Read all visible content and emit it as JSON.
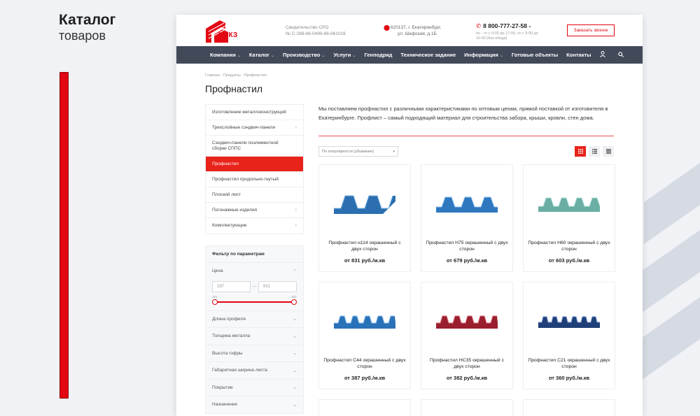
{
  "presentation": {
    "title_line1": "Каталог",
    "title_line2": "товаров"
  },
  "header": {
    "logo_text": "ЦСКЗ",
    "sro_line1": "Свидетельство СРО",
    "sro_line2": "№ С-288-66-0499-66-061016",
    "address_line1": "620137, г. Екатеринбург,",
    "address_line2": "ул. Шефская, д.1Б",
    "phone": "8 800-777-27-58",
    "phone_chevron": "▾",
    "hours": "пн - чт с 9:00 до 17:00, пт с 9:00 до 16:00 (без обеда)",
    "callback_label": "Заказать звонок"
  },
  "nav": {
    "items": [
      {
        "label": "Компания",
        "dropdown": "⌄"
      },
      {
        "label": "Каталог",
        "dropdown": "⌄"
      },
      {
        "label": "Производство",
        "dropdown": "⌄"
      },
      {
        "label": "Услуги",
        "dropdown": "⌄"
      },
      {
        "label": "Генподряд",
        "dropdown": ""
      },
      {
        "label": "Техническое задание",
        "dropdown": ""
      },
      {
        "label": "Информация",
        "dropdown": "⌄"
      },
      {
        "label": "Готовые объекты",
        "dropdown": ""
      },
      {
        "label": "Контакты",
        "dropdown": ""
      }
    ],
    "user_icon": "user-icon",
    "search_icon": "search-icon"
  },
  "breadcrumb": {
    "home": "Главная",
    "sep": "-",
    "products": "Продукты",
    "current": "Профнастил"
  },
  "page": {
    "title": "Профнастил"
  },
  "sidebar": {
    "categories": [
      {
        "label": "Изготовление металлоконструкций",
        "chevron": ""
      },
      {
        "label": "Трехслойные сэндвич-панели",
        "chevron": "›"
      },
      {
        "label": "Сэндвич-панели поэлементной сборки СППС",
        "chevron": ""
      },
      {
        "label": "Профнастил",
        "chevron": ""
      },
      {
        "label": "Профнастил продольно-гнутый",
        "chevron": ""
      },
      {
        "label": "Плоский лист",
        "chevron": ""
      },
      {
        "label": "Погонажные изделия",
        "chevron": "›"
      },
      {
        "label": "Комплектующие",
        "chevron": "›"
      }
    ],
    "filter": {
      "title": "Фильтр по параметрам",
      "price_label": "Цена",
      "price_from": "197",
      "price_to": "831",
      "range_min": "197",
      "range_max": "831",
      "dash": "—",
      "rows": [
        "Длина профиля",
        "Толщина металла",
        "Высота гофры",
        "Габаритная ширина листа",
        "Покрытие",
        "Назначение"
      ]
    }
  },
  "main": {
    "intro": "Мы поставляем профнастил с различными характеристиками по оптовым ценам, прямой поставкой от изготовителя в Екатеринбурге. Профлист – самый подходящий материал для строительства забора, крыши, кровли, стен дома.",
    "sort_label": "По популярности (убывание)",
    "sort_caret": "▾",
    "views": [
      "grid-view-icon",
      "list-view-icon",
      "table-view-icon"
    ],
    "products": [
      {
        "name": "Профнастил н114 окрашенный с двух сторон",
        "price": "от 831 руб./м.кв",
        "color": "#2b6fb0"
      },
      {
        "name": "Профнастил Н75 окрашенный с двух сторон",
        "price": "от 679 руб./м.кв",
        "color": "#2f78c0"
      },
      {
        "name": "Профнастил Н60 окрашенный с двух сторон",
        "price": "от 603 руб./м.кв",
        "color": "#6aaea4"
      },
      {
        "name": "Профнастил С44 окрашенный с двух сторон",
        "price": "от 387 руб./м.кв",
        "color": "#2a72b8"
      },
      {
        "name": "Профнастил НС35 окрашенный с двух сторон",
        "price": "от 382 руб./м.кв",
        "color": "#9a1f2e"
      },
      {
        "name": "Профнастил С21 окрашенный с двух сторон",
        "price": "от 360 руб./м.кв",
        "color": "#1f3f78"
      }
    ]
  },
  "colors": {
    "accent": "#e30613",
    "nav_bg": "#424a5a"
  }
}
